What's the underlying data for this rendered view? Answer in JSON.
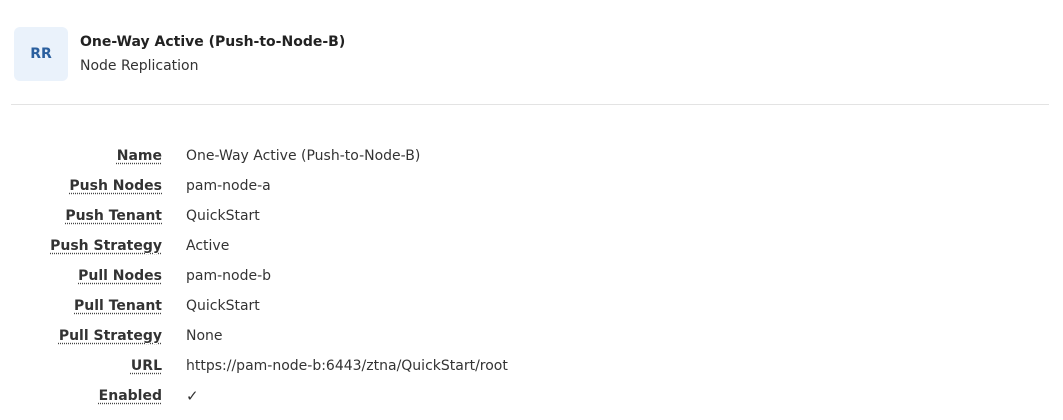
{
  "header": {
    "avatar_initials": "RR",
    "title": "One-Way Active (Push-to-Node-B)",
    "subtitle": "Node Replication"
  },
  "details": [
    {
      "label": "Name",
      "value": "One-Way Active (Push-to-Node-B)"
    },
    {
      "label": "Push Nodes",
      "value": "pam-node-a"
    },
    {
      "label": "Push Tenant",
      "value": "QuickStart"
    },
    {
      "label": "Push Strategy",
      "value": "Active"
    },
    {
      "label": "Pull Nodes",
      "value": "pam-node-b"
    },
    {
      "label": "Pull Tenant",
      "value": "QuickStart"
    },
    {
      "label": "Pull Strategy",
      "value": "None"
    },
    {
      "label": "URL",
      "value": "https://pam-node-b:6443/ztna/QuickStart/root"
    },
    {
      "label": "Enabled",
      "value": "✓",
      "icon": "checkmark-icon"
    }
  ],
  "colors": {
    "avatar_bg": "#eaf2fb",
    "avatar_text": "#2a5f9e",
    "divider": "#e3e3e3"
  }
}
